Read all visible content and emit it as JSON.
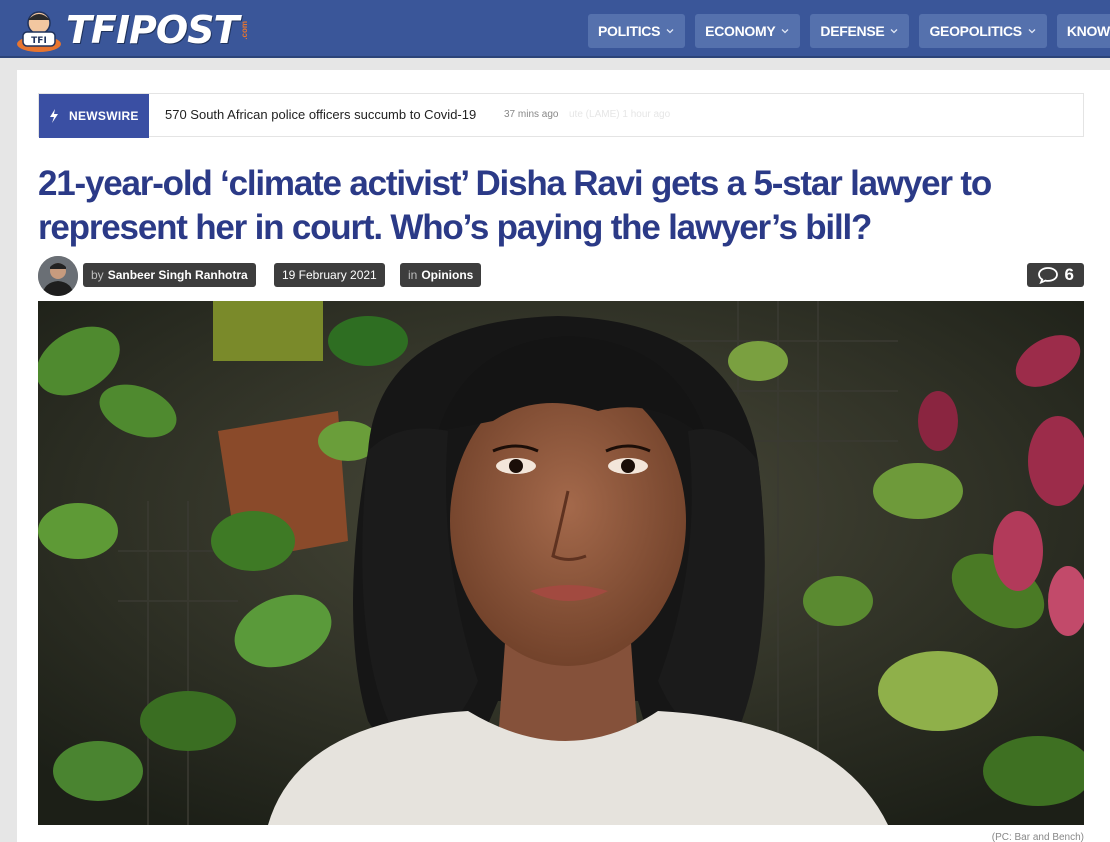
{
  "brand": {
    "logo_text": "TFIPOST",
    "logo_suffix": ".com",
    "mascot_text": "TFI",
    "accent_color": "#3a5699",
    "logo_orange": "#e8752e"
  },
  "nav": {
    "items": [
      {
        "label": "POLITICS"
      },
      {
        "label": "ECONOMY"
      },
      {
        "label": "DEFENSE"
      },
      {
        "label": "GEOPOLITICS"
      },
      {
        "label": "KNOWLEDG"
      }
    ]
  },
  "newswire": {
    "label": "NEWSWIRE",
    "headline": "570 South African police officers succumb to Covid-19",
    "time": "37 mins ago",
    "faded_text": "ute (LAME)   1 hour ago"
  },
  "article": {
    "title": "21-year-old ‘climate activist’ Disha Ravi gets a 5-star lawyer to represent her in court. Who’s paying the lawyer’s bill?",
    "title_color": "#2b3a87",
    "author_prefix": "by",
    "author": "Sanbeer Singh Ranhotra",
    "date": "19 February 2021",
    "category_prefix": "in",
    "category": "Opinions",
    "comment_count": "6",
    "image_caption": "(PC: Bar and Bench)"
  }
}
